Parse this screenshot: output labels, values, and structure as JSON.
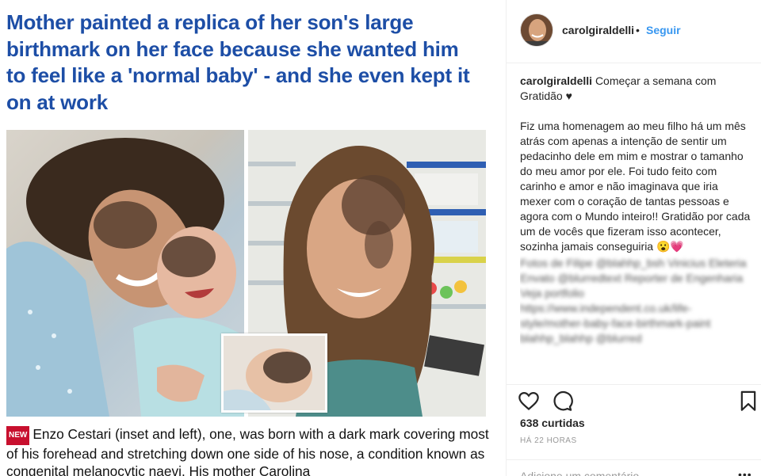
{
  "article": {
    "headline": "Mother painted a replica of her son's large birthmark on her face because she wanted him to feel like a 'normal baby' - and she even kept it on at work",
    "badge": "NEW",
    "caption": "Enzo Cestari (inset and left), one, was born with a dark mark covering most of his forehead and stretching down one side of his nose, a condition known as congenital melanocytic naevi. His mother Carolina"
  },
  "instagram": {
    "username": "carolgiraldelli",
    "separator": "•",
    "follow_label": "Seguir",
    "post": {
      "author": "carolgiraldelli",
      "intro": "Começar a semana com Gratidão ♥",
      "body": "Fiz uma homenagem ao meu filho há um mês atrás com apenas a intenção de sentir um pedacinho dele em mim e mostrar o tamanho do meu amor por ele. Foi tudo feito com carinho e amor e não imaginava que iria mexer com o coração de tantas pessoas e agora com o Mundo inteiro!! Gratidão por cada um de vocês que fizeram isso acontecer, sozinha jamais conseguiria 😮💗",
      "blurred": "Fotos de Filipe @blahhp_bsh Vinicius Eleteria Envato @blurredtext Reporter de Engenharia Veja portfolio https://www.independent.co.uk/life-style/mother-baby-face-birthmark-paint blahhp_blahhp @blurred"
    },
    "icons": {
      "like": "heart-icon",
      "comment": "comment-bubble-icon",
      "save": "bookmark-icon"
    },
    "likes": "638 curtidas",
    "timestamp": "HÁ 22 HORAS",
    "comment_placeholder": "Adicione um comentário...",
    "more_label": "•••"
  }
}
